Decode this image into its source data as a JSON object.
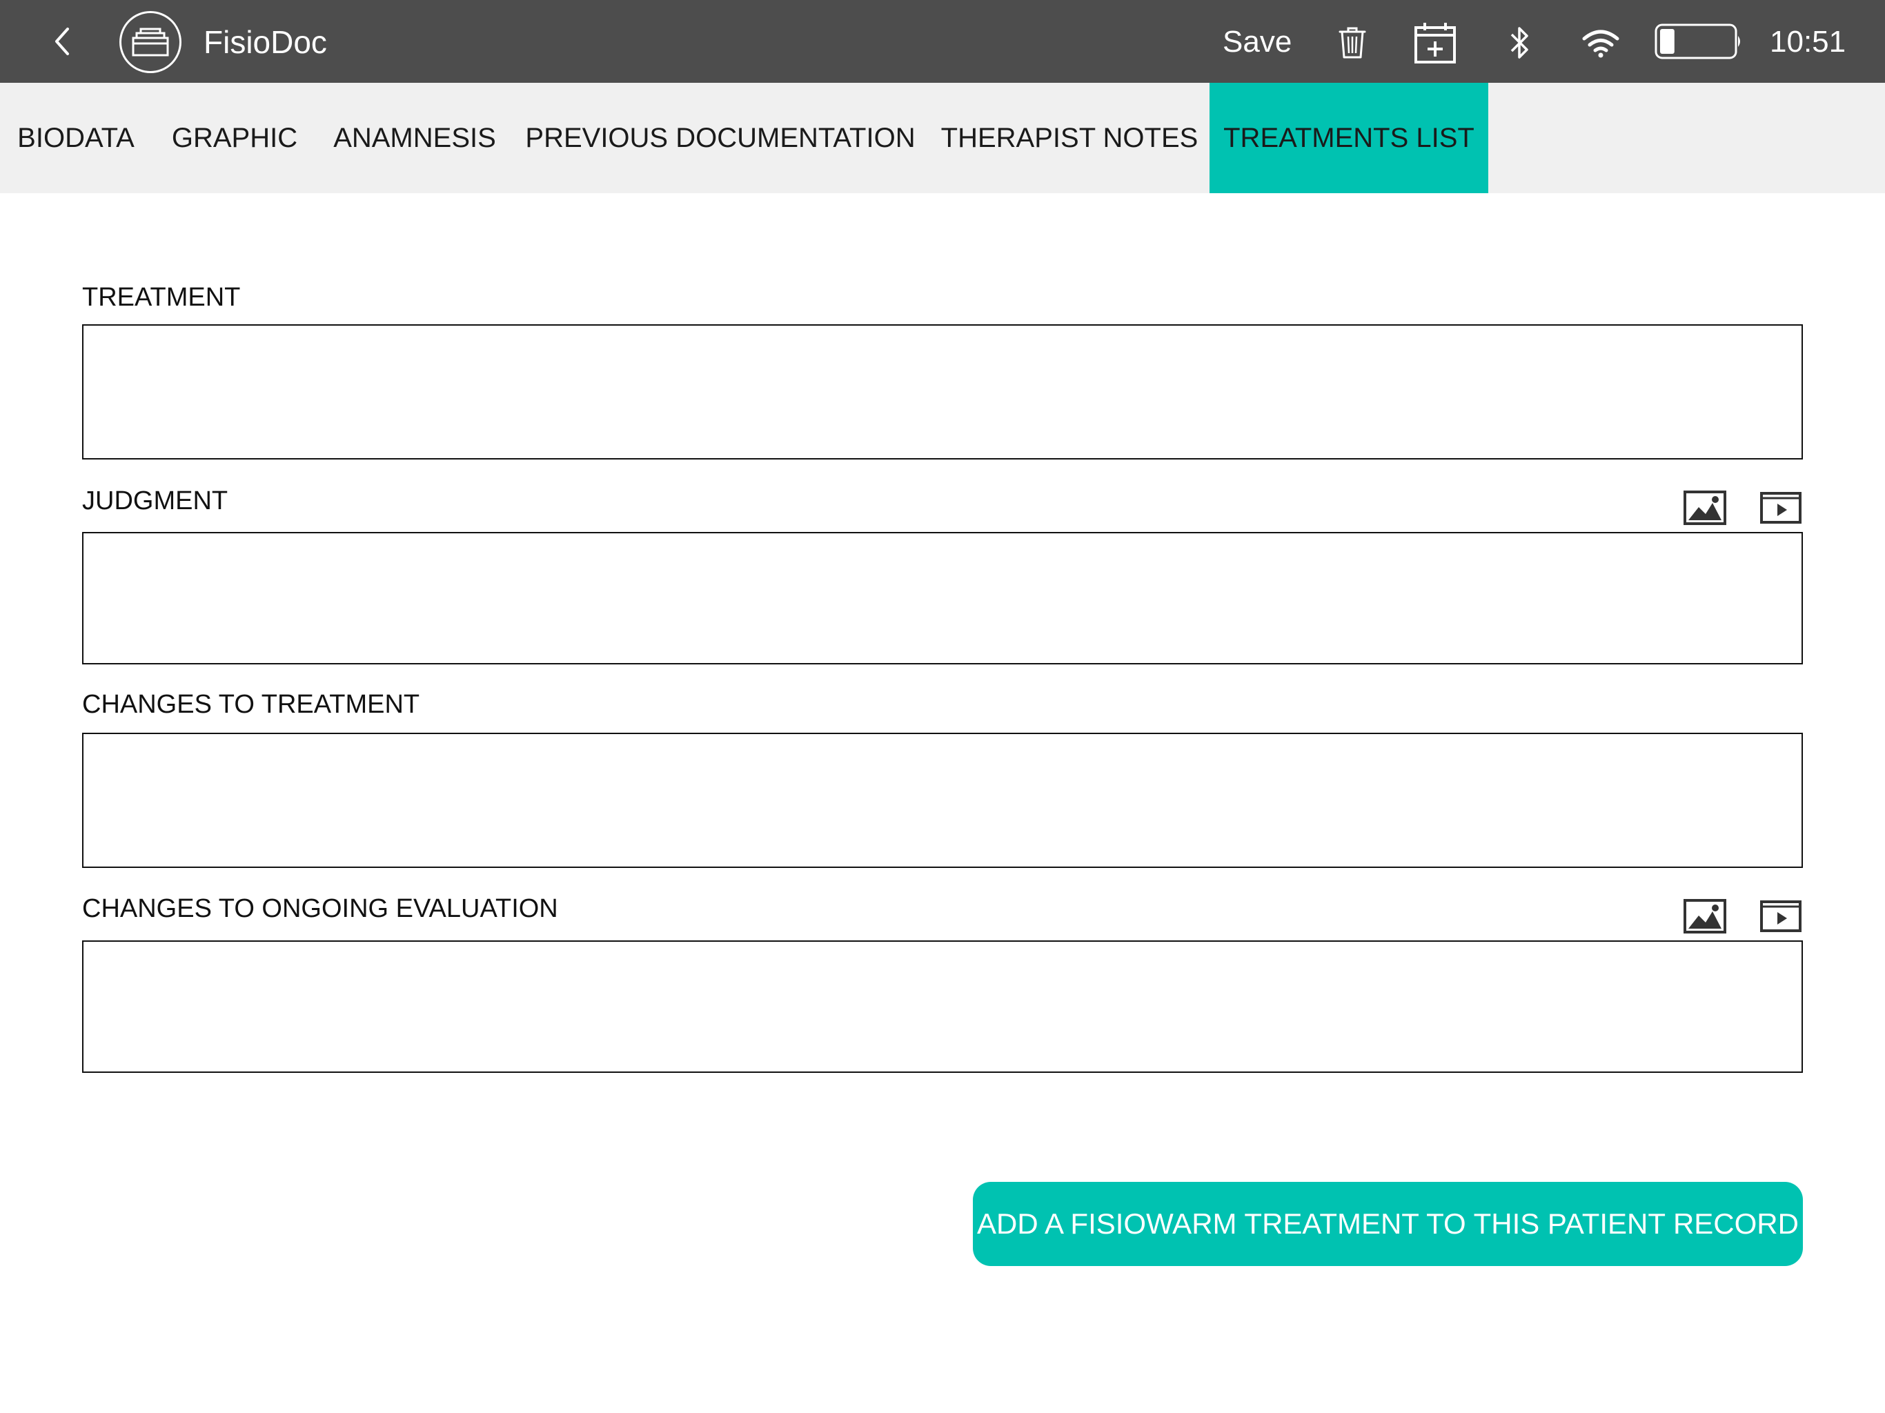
{
  "header": {
    "back_icon": "chevron-left-icon",
    "logo_icon": "folder-box-icon",
    "app_title": "FisioDoc",
    "save_label": "Save",
    "icons": [
      "trash-icon",
      "calendar-add-icon",
      "bluetooth-icon",
      "wifi-icon",
      "battery-icon"
    ],
    "battery_level": 0.2,
    "clock": "10:51",
    "background_color": "#4d4d4d"
  },
  "tabs": [
    {
      "label": "BIODATA",
      "active": false
    },
    {
      "label": "GRAPHIC",
      "active": false
    },
    {
      "label": "ANAMNESIS",
      "active": false
    },
    {
      "label": "PREVIOUS DOCUMENTATION",
      "active": false
    },
    {
      "label": "THERAPIST NOTES",
      "active": false
    },
    {
      "label": "TREATMENTS LIST",
      "active": true
    }
  ],
  "form": {
    "treatment": {
      "label": "TREATMENT",
      "value": ""
    },
    "judgment": {
      "label": "JUDGMENT",
      "value": "",
      "icons": [
        "image-icon",
        "video-icon"
      ]
    },
    "changes_to_treatment": {
      "label": "CHANGES TO TREATMENT",
      "value": ""
    },
    "changes_to_ongoing_evaluation": {
      "label": "CHANGES TO ONGOING EVALUATION",
      "value": "",
      "icons": [
        "image-icon",
        "video-icon"
      ]
    }
  },
  "actions": {
    "add_treatment_label": "ADD A FISIOWARM TREATMENT TO THIS PATIENT RECORD"
  },
  "colors": {
    "accent": "#00c2b1",
    "tab_bar": "#f0f0f0"
  }
}
